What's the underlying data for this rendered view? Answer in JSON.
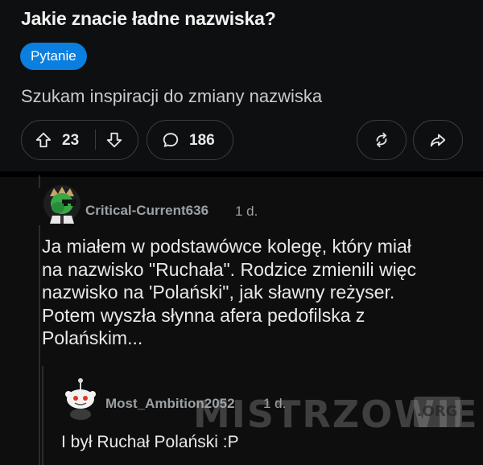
{
  "post": {
    "title": "Jakie znacie ładne nazwiska?",
    "flair": "Pytanie",
    "body": "Szukam inspiracji do zmiany nazwiska",
    "upvotes": "23",
    "comments_count": "186"
  },
  "comments": [
    {
      "author": "Critical-Current636",
      "age": "1 d.",
      "lines": [
        "Ja miałem w podstawówce kolegę, który miał",
        "na nazwisko \"Ruchała\". Rodzice zmienili więc",
        "nazwisko na 'Polański\", jak sławny reżyser.",
        "Potem wyszła słynna afera pedofilska z",
        "Polańskim..."
      ]
    },
    {
      "author": "Most_Ambition2052",
      "age": "1 d.",
      "text": "I był Ruchał Polański :P"
    }
  ],
  "watermark": {
    "text": "MISTRZOWIE",
    "badge": ".ORG"
  },
  "colors": {
    "flair_bg": "#0a7fe0",
    "background": "#0e0e0e",
    "meta_text": "#9ba0a4"
  },
  "icons": [
    "upvote-icon",
    "downvote-icon",
    "comment-icon",
    "crosspost-icon",
    "share-icon"
  ]
}
